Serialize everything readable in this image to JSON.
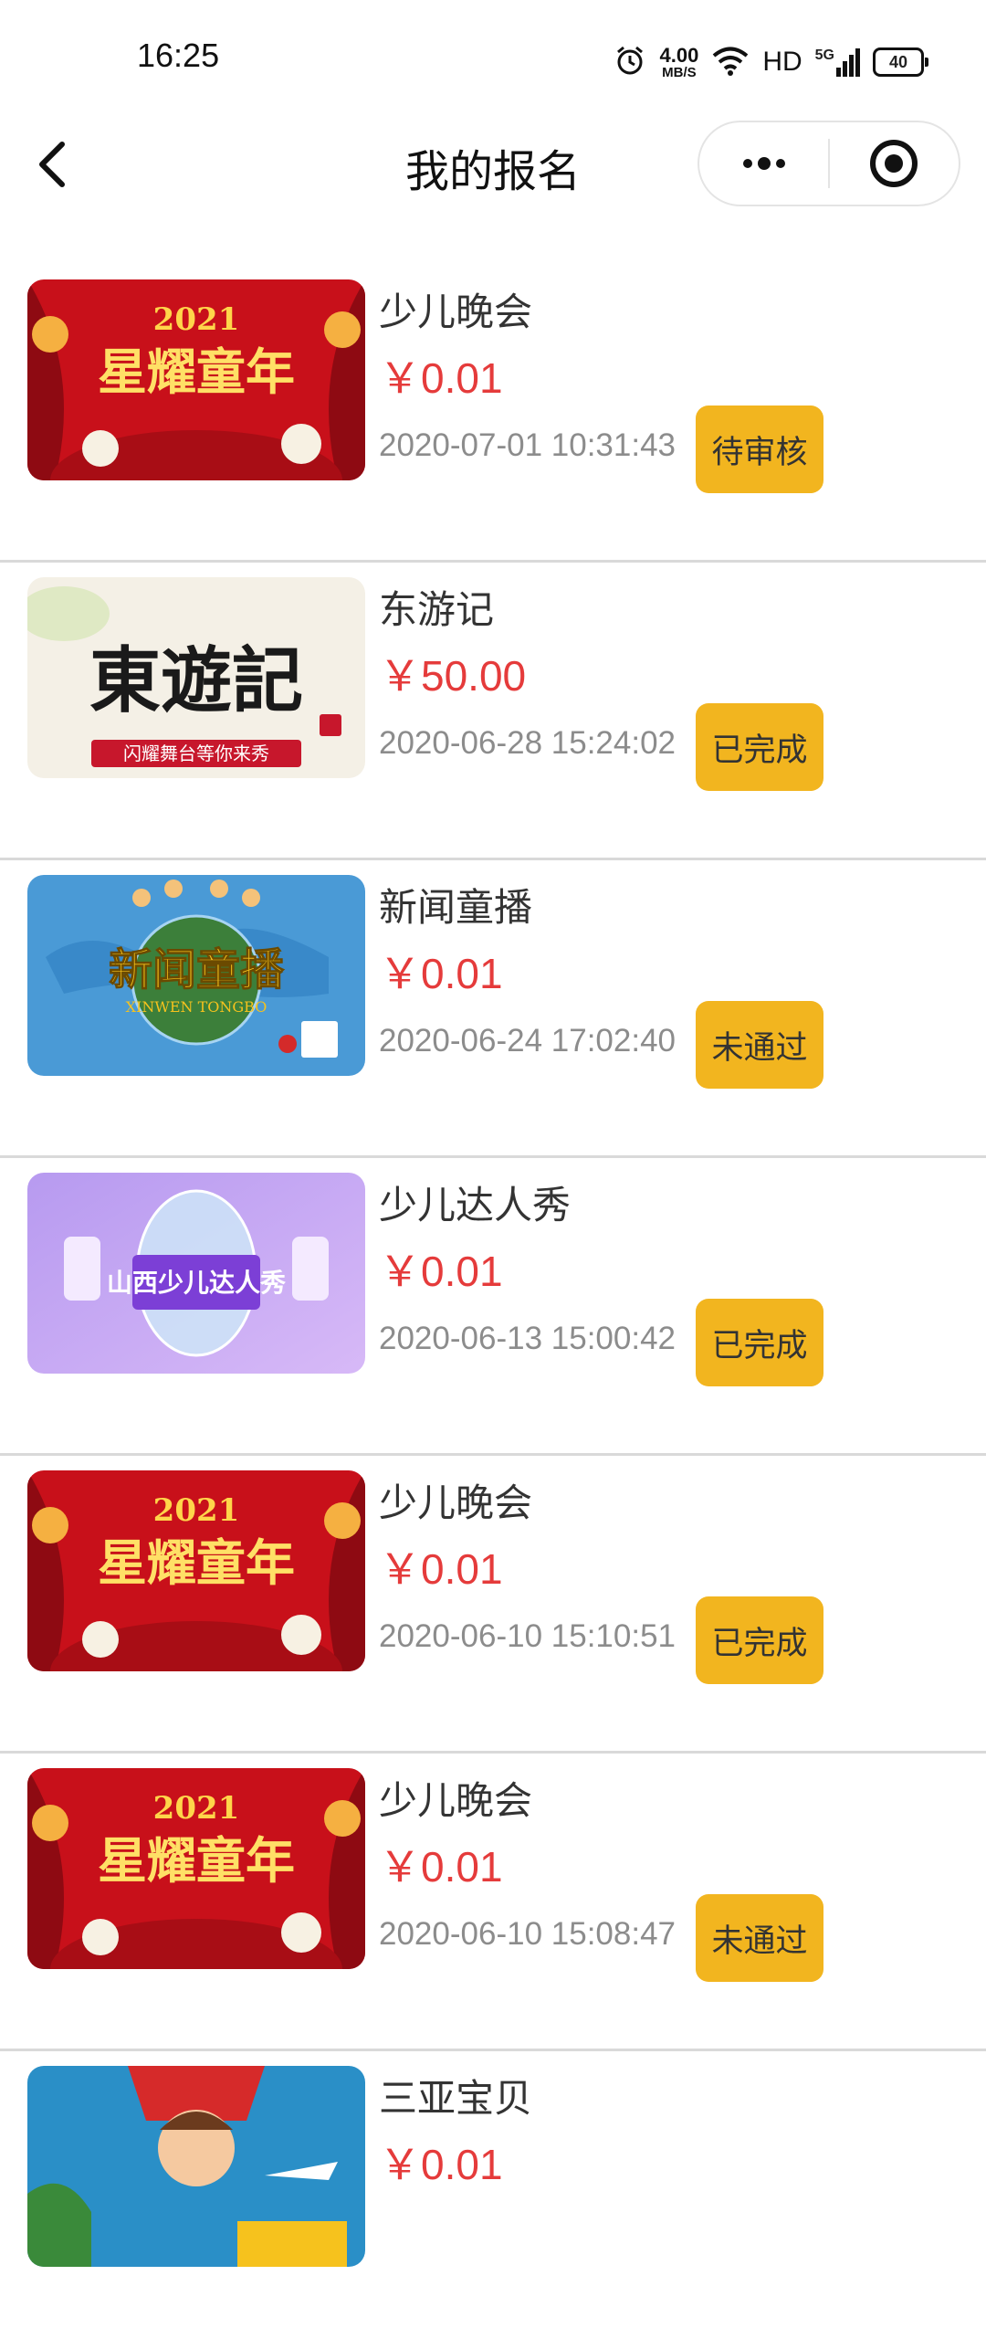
{
  "status_bar": {
    "time": "16:25",
    "net_speed_value": "4.00",
    "net_speed_unit": "MB/S",
    "hd": "HD",
    "signal": "5G",
    "battery": "40"
  },
  "nav": {
    "title": "我的报名",
    "more_icon": "more-dots-icon",
    "close_icon": "target-circle-icon"
  },
  "colors": {
    "price": "#e53b3b",
    "status_button": "#f2b51f"
  },
  "items": [
    {
      "name": "少儿晚会",
      "price": "￥0.01",
      "date": "2020-07-01 10:31:43",
      "status": "待审核",
      "poster": {
        "title": "星耀童年",
        "year": "2021"
      }
    },
    {
      "name": "东游记",
      "price": "￥50.00",
      "date": "2020-06-28 15:24:02",
      "status": "已完成",
      "poster": {
        "title": "東遊記",
        "banner": "闪耀舞台等你来秀"
      }
    },
    {
      "name": "新闻童播",
      "price": "￥0.01",
      "date": "2020-06-24 17:02:40",
      "status": "未通过",
      "poster": {
        "title": "新闻童播",
        "subtitle": "XINWEN TONGBO"
      }
    },
    {
      "name": "少儿达人秀",
      "price": "￥0.01",
      "date": "2020-06-13 15:00:42",
      "status": "已完成",
      "poster": {
        "title": "山西少儿达人秀"
      }
    },
    {
      "name": "少儿晚会",
      "price": "￥0.01",
      "date": "2020-06-10 15:10:51",
      "status": "已完成",
      "poster": {
        "title": "星耀童年",
        "year": "2021"
      }
    },
    {
      "name": "少儿晚会",
      "price": "￥0.01",
      "date": "2020-06-10 15:08:47",
      "status": "未通过",
      "poster": {
        "title": "星耀童年",
        "year": "2021"
      }
    },
    {
      "name": "三亚宝贝",
      "price": "￥0.01",
      "date": "",
      "status": "",
      "poster": {
        "title": ""
      }
    }
  ]
}
